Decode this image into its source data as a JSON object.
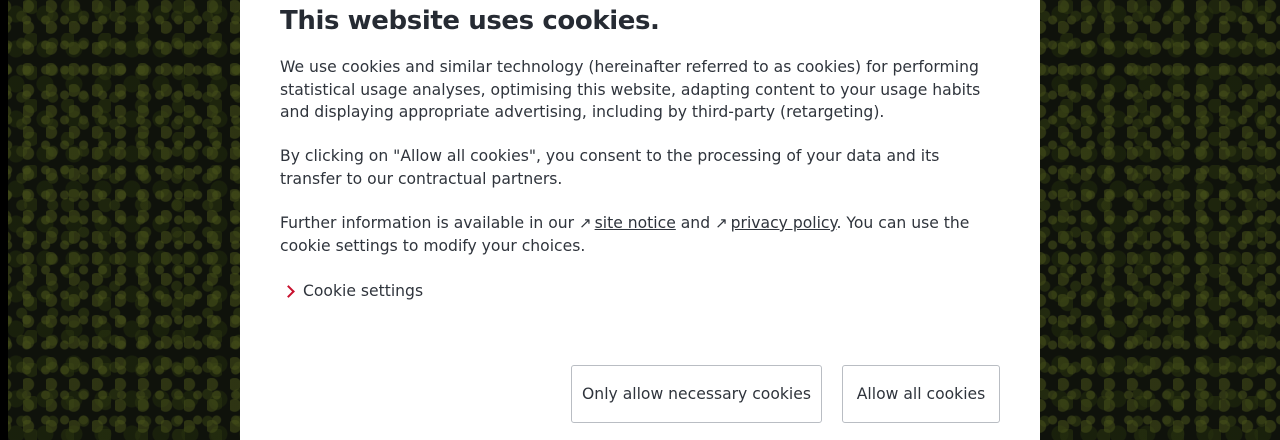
{
  "dialog": {
    "title": "This website uses cookies.",
    "paragraph1": "We use cookies and similar technology (hereinafter referred to as cookies) for performing statistical usage analyses, optimising this website, adapting content to your usage habits and displaying appropriate advertising, including by third-party (retargeting).",
    "paragraph2": "By clicking on \"Allow all cookies\", you consent to the processing of your data and its transfer to our contractual partners.",
    "paragraph3": {
      "intro": "Further information is available in our ",
      "site_notice_label": "site notice",
      "between": " and ",
      "privacy_policy_label": "privacy policy",
      "outro": ". You can use the cookie settings to modify your choices.",
      "external_arrow": "↗"
    },
    "cookie_settings_label": "Cookie settings",
    "buttons": {
      "necessary_label": "Only allow necessary cookies",
      "allow_all_label": "Allow all cookies"
    }
  },
  "colors": {
    "accent": "#c8102e",
    "text": "#2f343c",
    "button_border": "#b9bdc3"
  },
  "icons": {
    "external_link": "arrow-up-right-icon",
    "expand": "chevron-right-icon"
  }
}
